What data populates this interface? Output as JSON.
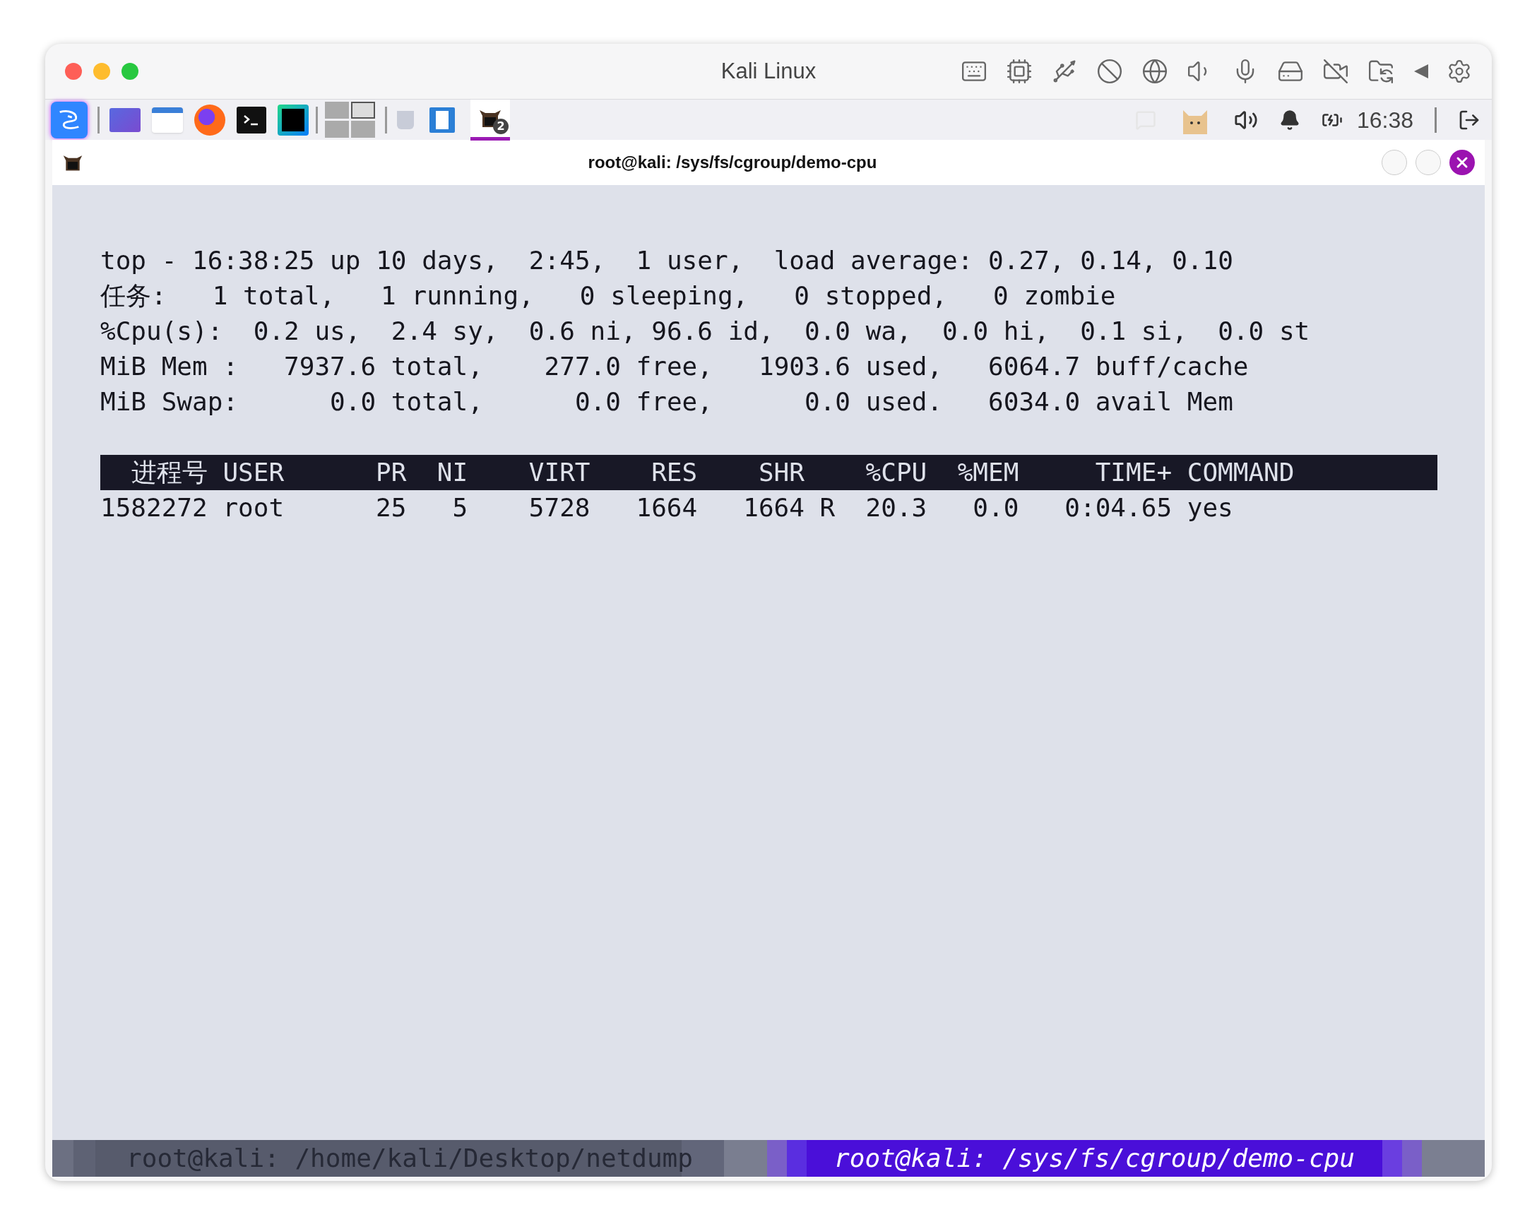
{
  "host_window": {
    "title": "Kali Linux"
  },
  "taskbar": {
    "workspaces": [
      {
        "selected": false
      },
      {
        "selected": true
      },
      {
        "selected": false
      },
      {
        "selected": false
      }
    ],
    "active_app": {
      "badge": "2",
      "selected": true
    },
    "clock": "16:38"
  },
  "terminal": {
    "title": "root@kali: /sys/fs/cgroup/demo-cpu",
    "summary_lines": [
      "top - 16:38:25 up 10 days,  2:45,  1 user,  load average: 0.27, 0.14, 0.10",
      "任务:   1 total,   1 running,   0 sleeping,   0 stopped,   0 zombie",
      "%Cpu(s):  0.2 us,  2.4 sy,  0.6 ni, 96.6 id,  0.0 wa,  0.0 hi,  0.1 si,  0.0 st",
      "MiB Mem :   7937.6 total,    277.0 free,   1903.6 used,   6064.7 buff/cache",
      "MiB Swap:      0.0 total,      0.0 free,      0.0 used.   6034.0 avail Mem"
    ],
    "columns": [
      "进程号",
      "USER",
      "PR",
      "NI",
      "VIRT",
      "RES",
      "SHR",
      "",
      "%CPU",
      "%MEM",
      "TIME+",
      "COMMAND"
    ],
    "rows": [
      [
        "1582272",
        "root",
        "25",
        "5",
        "5728",
        "1664",
        "1664",
        "R",
        "20.3",
        "0.0",
        "0:04.65",
        "yes"
      ]
    ]
  },
  "tabs": [
    {
      "label": "root@kali: /home/kali/Desktop/netdump",
      "selected": false
    },
    {
      "label": "root@kali: /sys/fs/cgroup/demo-cpu",
      "selected": true
    }
  ]
}
